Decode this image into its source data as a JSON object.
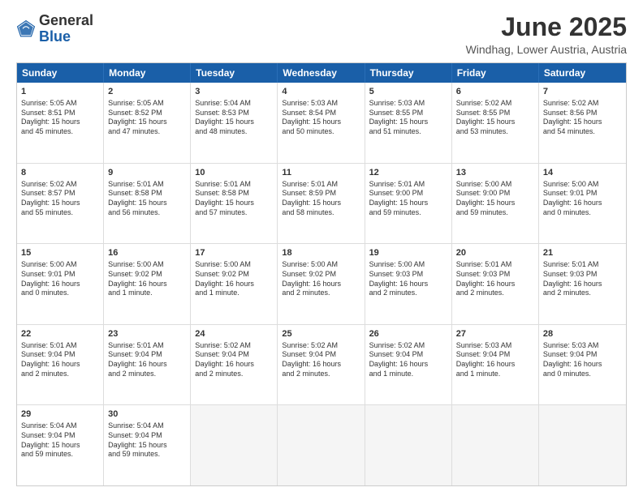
{
  "header": {
    "logo_general": "General",
    "logo_blue": "Blue",
    "month_title": "June 2025",
    "location": "Windhag, Lower Austria, Austria"
  },
  "calendar": {
    "days": [
      "Sunday",
      "Monday",
      "Tuesday",
      "Wednesday",
      "Thursday",
      "Friday",
      "Saturday"
    ],
    "rows": [
      [
        {
          "day": "1",
          "lines": [
            "Sunrise: 5:05 AM",
            "Sunset: 8:51 PM",
            "Daylight: 15 hours",
            "and 45 minutes."
          ]
        },
        {
          "day": "2",
          "lines": [
            "Sunrise: 5:05 AM",
            "Sunset: 8:52 PM",
            "Daylight: 15 hours",
            "and 47 minutes."
          ]
        },
        {
          "day": "3",
          "lines": [
            "Sunrise: 5:04 AM",
            "Sunset: 8:53 PM",
            "Daylight: 15 hours",
            "and 48 minutes."
          ]
        },
        {
          "day": "4",
          "lines": [
            "Sunrise: 5:03 AM",
            "Sunset: 8:54 PM",
            "Daylight: 15 hours",
            "and 50 minutes."
          ]
        },
        {
          "day": "5",
          "lines": [
            "Sunrise: 5:03 AM",
            "Sunset: 8:55 PM",
            "Daylight: 15 hours",
            "and 51 minutes."
          ]
        },
        {
          "day": "6",
          "lines": [
            "Sunrise: 5:02 AM",
            "Sunset: 8:55 PM",
            "Daylight: 15 hours",
            "and 53 minutes."
          ]
        },
        {
          "day": "7",
          "lines": [
            "Sunrise: 5:02 AM",
            "Sunset: 8:56 PM",
            "Daylight: 15 hours",
            "and 54 minutes."
          ]
        }
      ],
      [
        {
          "day": "8",
          "lines": [
            "Sunrise: 5:02 AM",
            "Sunset: 8:57 PM",
            "Daylight: 15 hours",
            "and 55 minutes."
          ]
        },
        {
          "day": "9",
          "lines": [
            "Sunrise: 5:01 AM",
            "Sunset: 8:58 PM",
            "Daylight: 15 hours",
            "and 56 minutes."
          ]
        },
        {
          "day": "10",
          "lines": [
            "Sunrise: 5:01 AM",
            "Sunset: 8:58 PM",
            "Daylight: 15 hours",
            "and 57 minutes."
          ]
        },
        {
          "day": "11",
          "lines": [
            "Sunrise: 5:01 AM",
            "Sunset: 8:59 PM",
            "Daylight: 15 hours",
            "and 58 minutes."
          ]
        },
        {
          "day": "12",
          "lines": [
            "Sunrise: 5:01 AM",
            "Sunset: 9:00 PM",
            "Daylight: 15 hours",
            "and 59 minutes."
          ]
        },
        {
          "day": "13",
          "lines": [
            "Sunrise: 5:00 AM",
            "Sunset: 9:00 PM",
            "Daylight: 15 hours",
            "and 59 minutes."
          ]
        },
        {
          "day": "14",
          "lines": [
            "Sunrise: 5:00 AM",
            "Sunset: 9:01 PM",
            "Daylight: 16 hours",
            "and 0 minutes."
          ]
        }
      ],
      [
        {
          "day": "15",
          "lines": [
            "Sunrise: 5:00 AM",
            "Sunset: 9:01 PM",
            "Daylight: 16 hours",
            "and 0 minutes."
          ]
        },
        {
          "day": "16",
          "lines": [
            "Sunrise: 5:00 AM",
            "Sunset: 9:02 PM",
            "Daylight: 16 hours",
            "and 1 minute."
          ]
        },
        {
          "day": "17",
          "lines": [
            "Sunrise: 5:00 AM",
            "Sunset: 9:02 PM",
            "Daylight: 16 hours",
            "and 1 minute."
          ]
        },
        {
          "day": "18",
          "lines": [
            "Sunrise: 5:00 AM",
            "Sunset: 9:02 PM",
            "Daylight: 16 hours",
            "and 2 minutes."
          ]
        },
        {
          "day": "19",
          "lines": [
            "Sunrise: 5:00 AM",
            "Sunset: 9:03 PM",
            "Daylight: 16 hours",
            "and 2 minutes."
          ]
        },
        {
          "day": "20",
          "lines": [
            "Sunrise: 5:01 AM",
            "Sunset: 9:03 PM",
            "Daylight: 16 hours",
            "and 2 minutes."
          ]
        },
        {
          "day": "21",
          "lines": [
            "Sunrise: 5:01 AM",
            "Sunset: 9:03 PM",
            "Daylight: 16 hours",
            "and 2 minutes."
          ]
        }
      ],
      [
        {
          "day": "22",
          "lines": [
            "Sunrise: 5:01 AM",
            "Sunset: 9:04 PM",
            "Daylight: 16 hours",
            "and 2 minutes."
          ]
        },
        {
          "day": "23",
          "lines": [
            "Sunrise: 5:01 AM",
            "Sunset: 9:04 PM",
            "Daylight: 16 hours",
            "and 2 minutes."
          ]
        },
        {
          "day": "24",
          "lines": [
            "Sunrise: 5:02 AM",
            "Sunset: 9:04 PM",
            "Daylight: 16 hours",
            "and 2 minutes."
          ]
        },
        {
          "day": "25",
          "lines": [
            "Sunrise: 5:02 AM",
            "Sunset: 9:04 PM",
            "Daylight: 16 hours",
            "and 2 minutes."
          ]
        },
        {
          "day": "26",
          "lines": [
            "Sunrise: 5:02 AM",
            "Sunset: 9:04 PM",
            "Daylight: 16 hours",
            "and 1 minute."
          ]
        },
        {
          "day": "27",
          "lines": [
            "Sunrise: 5:03 AM",
            "Sunset: 9:04 PM",
            "Daylight: 16 hours",
            "and 1 minute."
          ]
        },
        {
          "day": "28",
          "lines": [
            "Sunrise: 5:03 AM",
            "Sunset: 9:04 PM",
            "Daylight: 16 hours",
            "and 0 minutes."
          ]
        }
      ],
      [
        {
          "day": "29",
          "lines": [
            "Sunrise: 5:04 AM",
            "Sunset: 9:04 PM",
            "Daylight: 15 hours",
            "and 59 minutes."
          ]
        },
        {
          "day": "30",
          "lines": [
            "Sunrise: 5:04 AM",
            "Sunset: 9:04 PM",
            "Daylight: 15 hours",
            "and 59 minutes."
          ]
        },
        {
          "day": "",
          "lines": []
        },
        {
          "day": "",
          "lines": []
        },
        {
          "day": "",
          "lines": []
        },
        {
          "day": "",
          "lines": []
        },
        {
          "day": "",
          "lines": []
        }
      ]
    ]
  }
}
